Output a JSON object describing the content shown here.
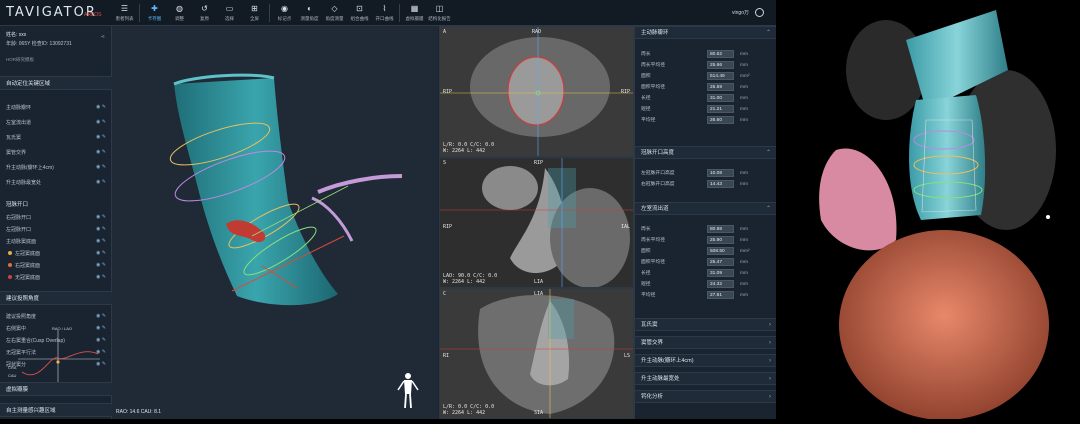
{
  "app": {
    "logo": "TAVIGATOR",
    "logo_sub": "ARBOS"
  },
  "toolbar": [
    {
      "icon": "☰",
      "label": "患者列表"
    },
    {
      "icon": "✚",
      "label": "卡存图"
    },
    {
      "icon": "◍",
      "label": "调整"
    },
    {
      "icon": "↺",
      "label": "复原"
    },
    {
      "icon": "▭",
      "label": "选择"
    },
    {
      "icon": "⊞",
      "label": "全屏"
    },
    {
      "icon": "◉",
      "label": "标记点"
    },
    {
      "icon": "◐",
      "label": "测量角度"
    },
    {
      "icon": "◇",
      "label": "角度测量"
    },
    {
      "icon": "⊡",
      "label": "组合曲线"
    },
    {
      "icon": "⌇",
      "label": "开口曲线"
    },
    {
      "icon": "▦",
      "label": "虚拟瓣膜"
    },
    {
      "icon": "◫",
      "label": "结构化报告"
    }
  ],
  "user": {
    "name": "vingo万"
  },
  "patient": {
    "name_label": "姓名: xxx",
    "info": "年龄: 065Y 检查ID: 13092731",
    "section_label": "HOR研究模板"
  },
  "left": {
    "auto_region": "自动定位关键区域",
    "items1": [
      "主动脉瓣环",
      "左室流出道",
      "瓦氏窦",
      "窦管交界",
      "升主动脉(瓣环上4cm)",
      "升主动脉最宽处"
    ],
    "coronary_head": "冠脉开口",
    "coronary_items": [
      "右冠脉开口",
      "左冠脉开口",
      "主动脉窦底面",
      "左冠窦底面",
      "右冠窦底面",
      "无冠窦底面"
    ],
    "proj_head": "建议投照角度",
    "proj_items": [
      "建议投照角度",
      "右侧窦中",
      "左右窦重合(Cusp Overlap)",
      "无冠窦平行法",
      "冠状窦分"
    ],
    "curve_label_a": "RAO / LAO",
    "curve_label_b": "CRA",
    "curve_label_c": "CAU",
    "angle_readout": "RAO: 14.6  CAU: 8.1",
    "bottom1": "虚拟瓣膜",
    "bottom2": "自主测量感兴趣区域"
  },
  "mpr": [
    {
      "top_left": "A",
      "side_left": "RIP",
      "side_right": "RIP",
      "top_mark": "RAO",
      "bottom_left": "L/R: 0.0 C/C: 0.0\nW: 2264 L: 442"
    },
    {
      "top_left": "S",
      "side_left": "RIP",
      "side_right": "IAL",
      "top_mark": "RIP",
      "bottom_left": "LAO: 90.0 C/C: 0.0\nW: 2264 L: 442",
      "bottom_mark": "LIA"
    },
    {
      "top_left": "C",
      "side_left": "RI",
      "side_right": "LS",
      "top_mark": "LIA",
      "bottom_left": "L/R: 0.0 C/C: 0.0\nW: 2264 L: 442",
      "bottom_mark": "SIA"
    }
  ],
  "right": {
    "sec1": "主动脉瓣环",
    "rows1": [
      {
        "label": "周长",
        "value": "80.62",
        "unit": "mm"
      },
      {
        "label": "周长平均径",
        "value": "25.66",
        "unit": "mm"
      },
      {
        "label": "面积",
        "value": "514.49",
        "unit": "mm²"
      },
      {
        "label": "面积平均径",
        "value": "25.59",
        "unit": "mm"
      },
      {
        "label": "长径",
        "value": "31.00",
        "unit": "mm"
      },
      {
        "label": "短径",
        "value": "21.21",
        "unit": "mm"
      },
      {
        "label": "平均径",
        "value": "26.60",
        "unit": "mm"
      }
    ],
    "sec2": "冠脉开口高度",
    "rows2": [
      {
        "label": "左冠脉开口高度",
        "value": "10.08",
        "unit": "mm"
      },
      {
        "label": "右冠脉开口高度",
        "value": "14.43",
        "unit": "mm"
      }
    ],
    "sec3": "左室流出道",
    "rows3": [
      {
        "label": "周长",
        "value": "80.98",
        "unit": "mm"
      },
      {
        "label": "周长平均径",
        "value": "25.90",
        "unit": "mm"
      },
      {
        "label": "面积",
        "value": "508.50",
        "unit": "mm²"
      },
      {
        "label": "面积平均径",
        "value": "25.47",
        "unit": "mm"
      },
      {
        "label": "长径",
        "value": "31.09",
        "unit": "mm"
      },
      {
        "label": "短径",
        "value": "24.32",
        "unit": "mm"
      },
      {
        "label": "平均径",
        "value": "27.81",
        "unit": "mm"
      }
    ],
    "collapsed": [
      "瓦氏窦",
      "窦管交界",
      "升主动脉(瓣环上4cm)",
      "升主动脉最宽处",
      "钙化分析"
    ]
  },
  "colors": {
    "accent": "#5ec0ff",
    "aorta": "#3fa9b0",
    "heart": "#d7795e",
    "background": "#1b2530"
  }
}
